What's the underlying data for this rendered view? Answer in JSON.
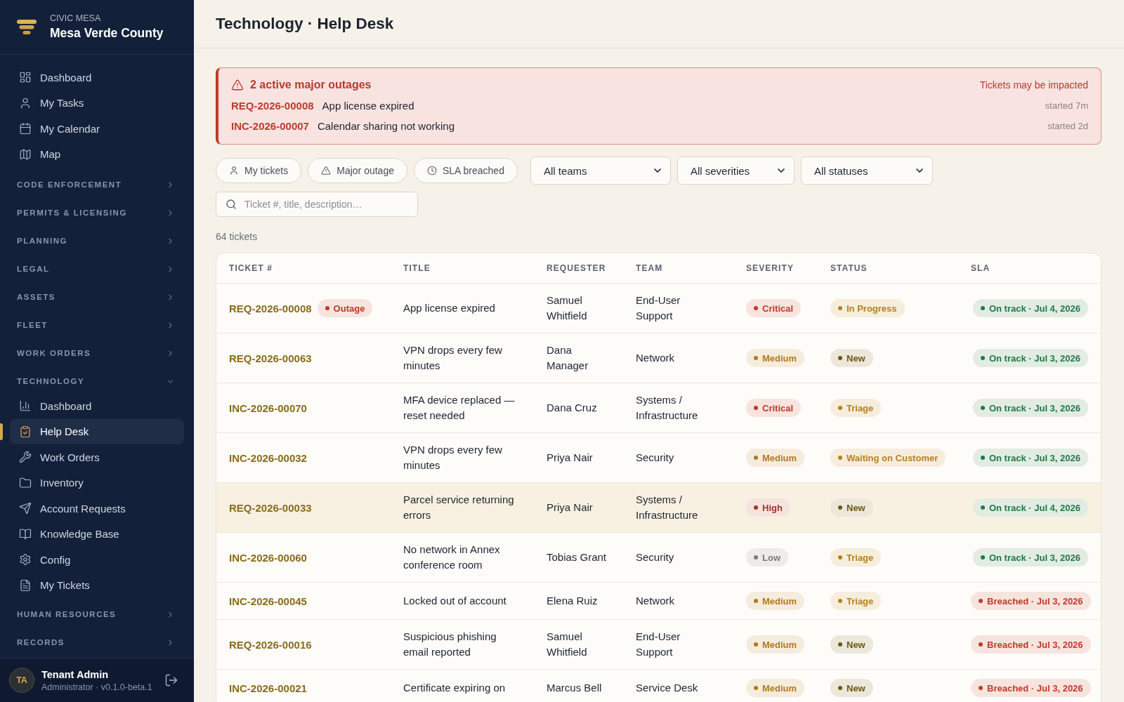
{
  "sidebar": {
    "brand": {
      "eyebrow": "CIVIC MESA",
      "name": "Mesa Verde County"
    },
    "items": [
      {
        "label": "Dashboard",
        "selected": false
      },
      {
        "label": "My Tasks",
        "selected": false
      },
      {
        "label": "My Calendar",
        "selected": false
      },
      {
        "label": "Map",
        "selected": false
      }
    ],
    "sections": [
      {
        "label": "CODE ENFORCEMENT",
        "expanded": false
      },
      {
        "label": "PERMITS & LICENSING",
        "expanded": false
      },
      {
        "label": "PLANNING",
        "expanded": false
      },
      {
        "label": "LEGAL",
        "expanded": false
      },
      {
        "label": "ASSETS",
        "expanded": false
      },
      {
        "label": "FLEET",
        "expanded": false
      },
      {
        "label": "WORK ORDERS",
        "expanded": false
      },
      {
        "label": "TECHNOLOGY",
        "expanded": true,
        "children": [
          {
            "label": "Dashboard",
            "selected": false
          },
          {
            "label": "Help Desk",
            "selected": true
          },
          {
            "label": "Work Orders",
            "selected": false
          },
          {
            "label": "Inventory",
            "selected": false
          },
          {
            "label": "Account Requests",
            "selected": false
          },
          {
            "label": "Knowledge Base",
            "selected": false
          },
          {
            "label": "Config",
            "selected": false
          },
          {
            "label": "My Tickets",
            "selected": false
          }
        ]
      },
      {
        "label": "HUMAN RESOURCES",
        "expanded": false
      },
      {
        "label": "RECORDS",
        "expanded": false
      }
    ],
    "user": {
      "initials": "TA",
      "name": "Tenant Admin",
      "role": "Administrator · v0.1.0-beta.1"
    }
  },
  "header": {
    "title": "Technology · Help Desk"
  },
  "alert": {
    "title": "2 active major outages",
    "note": "Tickets may be impacted",
    "items": [
      {
        "ticket": "REQ-2026-00008",
        "title": "App license expired",
        "started": "started 7m"
      },
      {
        "ticket": "INC-2026-00007",
        "title": "Calendar sharing not working",
        "started": "started 2d"
      }
    ]
  },
  "filters": {
    "chips": [
      {
        "label": "My tickets",
        "selected": false
      },
      {
        "label": "Major outage",
        "selected": false
      },
      {
        "label": "SLA breached",
        "selected": false
      }
    ],
    "selects": [
      {
        "value": "All teams"
      },
      {
        "value": "All severities"
      },
      {
        "value": "All statuses"
      }
    ],
    "search": {
      "placeholder": "Ticket #, title, description…"
    }
  },
  "count": "64 tickets",
  "table": {
    "columns": [
      "TICKET #",
      "TITLE",
      "REQUESTER",
      "TEAM",
      "SEVERITY",
      "STATUS",
      "SLA"
    ],
    "rows": [
      {
        "ticket": "REQ-2026-00008",
        "tag": {
          "label": "Outage",
          "color": "#c0392b"
        },
        "title": "App license expired",
        "requester": "Samuel Whitfield",
        "team": "End-User Support",
        "severity": {
          "label": "Critical",
          "color": "#c0392b"
        },
        "status": {
          "label": "In Progress",
          "color": "#b7801f"
        },
        "sla": {
          "label": "On track · Jul 4, 2026",
          "color": "#22784a"
        },
        "highlighted": false
      },
      {
        "ticket": "REQ-2026-00063",
        "title": "VPN drops every few minutes",
        "requester": "Dana Manager",
        "team": "Network",
        "severity": {
          "label": "Medium",
          "color": "#b07a1e"
        },
        "status": {
          "label": "New",
          "color": "#6e5711"
        },
        "sla": {
          "label": "On track · Jul 3, 2026",
          "color": "#22784a"
        },
        "highlighted": false
      },
      {
        "ticket": "INC-2026-00070",
        "title": "MFA device replaced — reset needed",
        "requester": "Dana Cruz",
        "team": "Systems / Infrastructure",
        "severity": {
          "label": "Critical",
          "color": "#c0392b"
        },
        "status": {
          "label": "Triage",
          "color": "#b7801f"
        },
        "sla": {
          "label": "On track · Jul 3, 2026",
          "color": "#22784a"
        },
        "highlighted": false
      },
      {
        "ticket": "INC-2026-00032",
        "title": "VPN drops every few minutes",
        "requester": "Priya Nair",
        "team": "Security",
        "severity": {
          "label": "Medium",
          "color": "#b07a1e"
        },
        "status": {
          "label": "Waiting on Customer",
          "color": "#b7801f"
        },
        "sla": {
          "label": "On track · Jul 3, 2026",
          "color": "#22784a"
        },
        "highlighted": false
      },
      {
        "ticket": "REQ-2026-00033",
        "title": "Parcel service returning errors",
        "requester": "Priya Nair",
        "team": "Systems / Infrastructure",
        "severity": {
          "label": "High",
          "color": "#a93226"
        },
        "status": {
          "label": "New",
          "color": "#6e5711"
        },
        "sla": {
          "label": "On track · Jul 4, 2026",
          "color": "#22784a"
        },
        "highlighted": true
      },
      {
        "ticket": "INC-2026-00060",
        "title": "No network in Annex conference room",
        "requester": "Tobias Grant",
        "team": "Security",
        "severity": {
          "label": "Low",
          "color": "#7a7a7a"
        },
        "status": {
          "label": "Triage",
          "color": "#b7801f"
        },
        "sla": {
          "label": "On track · Jul 3, 2026",
          "color": "#22784a"
        },
        "highlighted": false
      },
      {
        "ticket": "INC-2026-00045",
        "title": "Locked out of account",
        "requester": "Elena Ruiz",
        "team": "Network",
        "severity": {
          "label": "Medium",
          "color": "#b07a1e"
        },
        "status": {
          "label": "Triage",
          "color": "#b7801f"
        },
        "sla": {
          "label": "Breached · Jul 3, 2026",
          "color": "#c0392b"
        },
        "highlighted": false
      },
      {
        "ticket": "REQ-2026-00016",
        "title": "Suspicious phishing email reported",
        "requester": "Samuel Whitfield",
        "team": "End-User Support",
        "severity": {
          "label": "Medium",
          "color": "#b07a1e"
        },
        "status": {
          "label": "New",
          "color": "#6e5711"
        },
        "sla": {
          "label": "Breached · Jul 3, 2026",
          "color": "#c0392b"
        },
        "highlighted": false
      },
      {
        "ticket": "INC-2026-00021",
        "title": "Certificate expiring on",
        "requester": "Marcus Bell",
        "team": "Service Desk",
        "severity": {
          "label": "Medium",
          "color": "#b07a1e"
        },
        "status": {
          "label": "New",
          "color": "#6e5711"
        },
        "sla": {
          "label": "Breached · Jul 3, 2026",
          "color": "#c0392b"
        },
        "highlighted": false
      }
    ]
  }
}
